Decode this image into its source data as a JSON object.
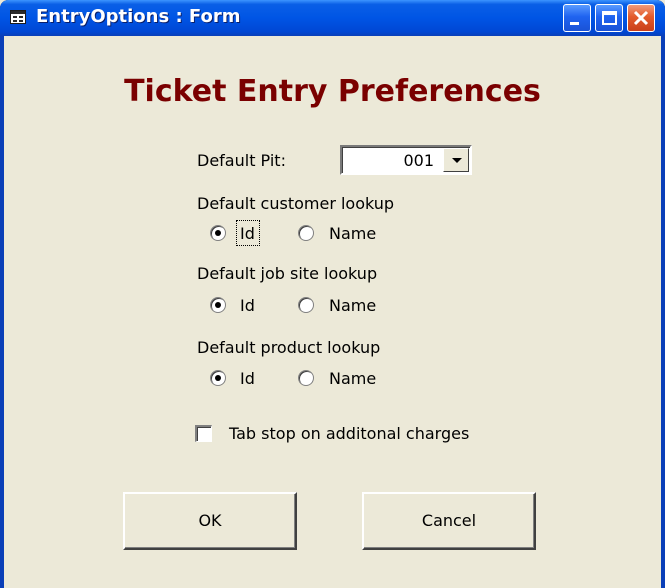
{
  "window": {
    "title": "EntryOptions : Form",
    "icon": "form-icon"
  },
  "form": {
    "heading": "Ticket Entry Preferences",
    "default_pit": {
      "label": "Default Pit:",
      "value": "001"
    },
    "customer_lookup": {
      "label": "Default customer lookup",
      "options": [
        "Id",
        "Name"
      ],
      "selected": "Id"
    },
    "jobsite_lookup": {
      "label": "Default job site lookup",
      "options": [
        "Id",
        "Name"
      ],
      "selected": "Id"
    },
    "product_lookup": {
      "label": "Default product lookup",
      "options": [
        "Id",
        "Name"
      ],
      "selected": "Id"
    },
    "tab_stop": {
      "label": "Tab stop on additonal charges",
      "checked": false
    },
    "ok_label": "OK",
    "cancel_label": "Cancel"
  },
  "colors": {
    "title_bar": "#0055e5",
    "heading": "#7a0000",
    "background": "#ece9d8",
    "close_button": "#e35b2c"
  }
}
